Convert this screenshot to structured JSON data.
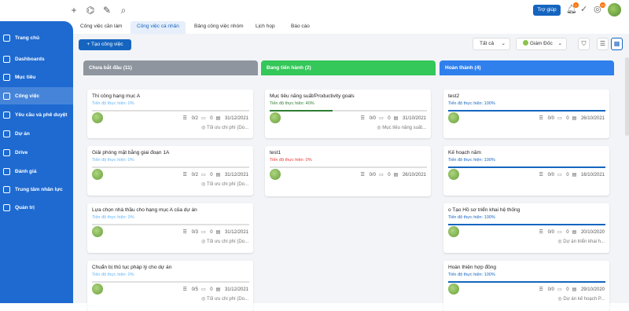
{
  "colors": {
    "primary": "#1565c0",
    "sidebar": "#1e6ad1",
    "todo_header": "#8e959e",
    "inprogress_header": "#34c759",
    "done_header": "#2f80ed",
    "progress_zero": "#e53935",
    "progress_green": "#2e7d32",
    "progress_blue": "#1565c0"
  },
  "topbar": {
    "icons": [
      "add-icon",
      "org-chart-icon",
      "pen-icon",
      "search-icon"
    ],
    "help_label": "Trợ giúp",
    "notif_count": "5",
    "badge_count": "10"
  },
  "sidebar": {
    "items": [
      {
        "label": "Trang chủ",
        "icon": "home-icon"
      },
      {
        "label": "Dashboards",
        "icon": "dashboard-icon"
      },
      {
        "label": "Mục tiêu",
        "icon": "target-icon"
      },
      {
        "label": "Công việc",
        "icon": "task-icon"
      },
      {
        "label": "Yêu cầu và phê duyệt",
        "icon": "request-icon"
      },
      {
        "label": "Dự án",
        "icon": "folder-icon"
      },
      {
        "label": "Drive",
        "icon": "drive-icon"
      },
      {
        "label": "Đánh giá",
        "icon": "review-icon"
      },
      {
        "label": "Trung tâm nhân lực",
        "icon": "people-icon"
      },
      {
        "label": "Quản trị",
        "icon": "settings-icon"
      }
    ]
  },
  "tabs": [
    "Công việc cần làm",
    "Công việc cá nhân",
    "Bảng công việc nhóm",
    "Lịch họp",
    "Báo cáo"
  ],
  "toolbar": {
    "create_label": "Tạo công việc",
    "filter_all": "Tất cả",
    "filter_role": "Giám Đốc"
  },
  "columns": [
    {
      "title": "Chưa bắt đầu (11)",
      "cards": [
        {
          "title": "Thi công hạng mục A",
          "progress": "Tiến độ thực hiện: 0%",
          "checklist": "0/2",
          "comments": "0",
          "date": "31/12/2021",
          "footer": "Tối ưu chi phí (Do..."
        },
        {
          "title": "Giải phóng mặt bằng giai đoạn 1A",
          "progress": "Tiến độ thực hiện: 0%",
          "checklist": "0/2",
          "comments": "0",
          "date": "31/12/2021",
          "footer": "Tối ưu chi phí (Do..."
        },
        {
          "title": "Lựa chọn nhà thầu cho hạng mục A của dự án",
          "progress": "Tiến độ thực hiện: 0%",
          "checklist": "0/3",
          "comments": "0",
          "date": "31/12/2021",
          "footer": "Tối ưu chi phí (Do..."
        },
        {
          "title": "Chuẩn bị thủ tục pháp lý cho dự án",
          "progress": "Tiến độ thực hiện: 0%",
          "checklist": "0/5",
          "comments": "0",
          "date": "31/12/2021",
          "footer": "Tối ưu chi phí (Do..."
        }
      ]
    },
    {
      "title": "Đang tiến hành (2)",
      "cards": [
        {
          "title": "Mục tiêu năng suất/Productivity goals",
          "progress": "Tiến độ thực hiện: 40%",
          "progress_value": 40,
          "checklist": "0/0",
          "comments": "0",
          "date": "31/10/2021",
          "footer": "Mục tiêu năng suất..."
        },
        {
          "title": "test1",
          "progress": "Tiến độ thực hiện: 0%",
          "checklist": "0/0",
          "comments": "0",
          "date": "26/10/2021",
          "footer": ""
        }
      ]
    },
    {
      "title": "Hoàn thành (4)",
      "cards": [
        {
          "title": "test2",
          "progress": "Tiến độ thực hiện: 100%",
          "progress_value": 100,
          "checklist": "0/0",
          "comments": "0",
          "date": "26/10/2021",
          "footer": ""
        },
        {
          "title": "Kế hoạch năm",
          "progress": "Tiến độ thực hiện: 100%",
          "progress_value": 100,
          "checklist": "0/0",
          "comments": "0",
          "date": "16/10/2021",
          "footer": ""
        },
        {
          "title": "o Tạo Hồ sơ triển khai hệ thống",
          "progress": "Tiến độ thực hiện: 100%",
          "progress_value": 100,
          "checklist": "0/0",
          "comments": "0",
          "date": "20/10/2020",
          "footer": "Dự án triển khai h..."
        },
        {
          "title": "Hoàn thiện hợp đồng",
          "progress": "Tiến độ thực hiện: 100%",
          "progress_value": 100,
          "checklist": "0/0",
          "comments": "0",
          "date": "29/10/2020",
          "footer": "Dự án kế hoạch P..."
        }
      ]
    }
  ]
}
